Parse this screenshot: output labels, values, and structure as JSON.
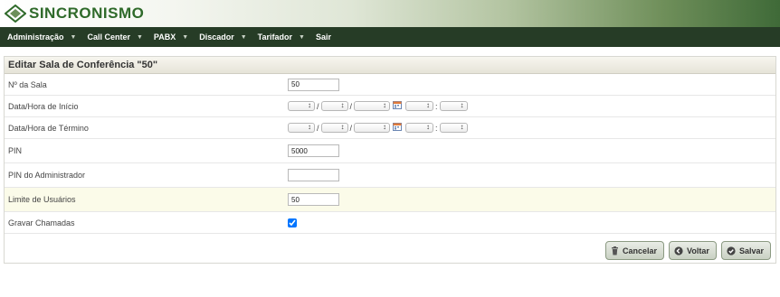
{
  "app": {
    "logo_text": "SINCRONISMO",
    "brand_color": "#2f6a2a"
  },
  "menu": {
    "items": [
      {
        "label": "Administração",
        "has_caret": true
      },
      {
        "label": "Call Center",
        "has_caret": true
      },
      {
        "label": "PABX",
        "has_caret": true
      },
      {
        "label": "Discador",
        "has_caret": true
      },
      {
        "label": "Tarifador",
        "has_caret": true
      },
      {
        "label": "Sair",
        "has_caret": false
      }
    ]
  },
  "panel": {
    "title": "Editar Sala de Conferência \"50\""
  },
  "form": {
    "room_number": {
      "label": "Nº da Sala",
      "value": "50"
    },
    "start": {
      "label": "Data/Hora de Início",
      "date_sep": "/",
      "time_sep": ":",
      "calendar_icon": "calendar-icon"
    },
    "end": {
      "label": "Data/Hora de Término",
      "date_sep": "/",
      "time_sep": ":",
      "calendar_icon": "calendar-icon"
    },
    "pin": {
      "label": "PIN",
      "value": "5000"
    },
    "admin_pin": {
      "label": "PIN do Administrador",
      "value": ""
    },
    "user_limit": {
      "label": "Limite de Usuários",
      "value": "50"
    },
    "record_calls": {
      "label": "Gravar Chamadas",
      "checked": true
    }
  },
  "buttons": {
    "cancel": {
      "label": "Cancelar",
      "icon": "trash-icon"
    },
    "back": {
      "label": "Voltar",
      "icon": "back-arrow-icon"
    },
    "save": {
      "label": "Salvar",
      "icon": "checkmark-icon"
    }
  },
  "colors": {
    "menubar": "#263c26",
    "highlight_row": "#fbfbe9",
    "button": "#c9d1c3"
  }
}
